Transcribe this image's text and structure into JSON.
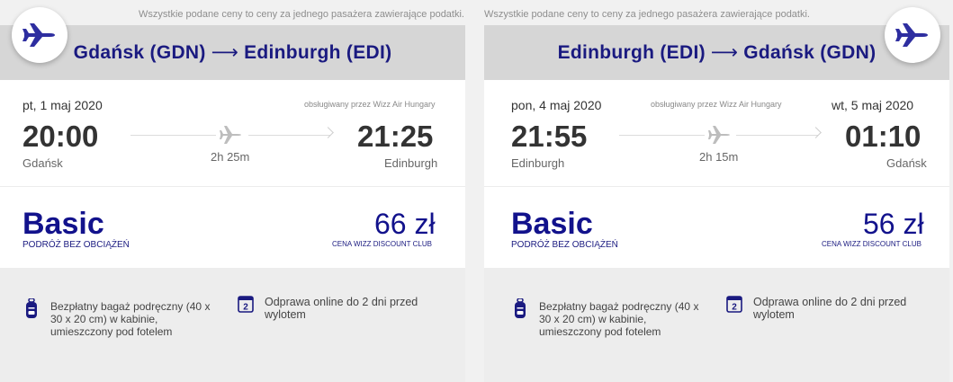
{
  "notice": "Wszystkie podane ceny to ceny za jednego pasażera zawierające podatki.",
  "flights": [
    {
      "route_from": "Gdańsk (GDN)",
      "route_arrow": "⟶",
      "route_to": "Edinburgh (EDI)",
      "dep_date": "pt, 1 maj 2020",
      "arr_date": "",
      "operator": "obsługiwany przez Wizz Air Hungary",
      "dep_time": "20:00",
      "arr_time": "21:25",
      "dep_city": "Gdańsk",
      "arr_city": "Edinburgh",
      "duration": "2h 25m",
      "fare_name": "Basic",
      "fare_sub": "PODRÓŻ BEZ OBCIĄŻEŃ",
      "price": "66 zł",
      "price_sub": "CENA WIZZ DISCOUNT CLUB",
      "perk_bag": "Bezpłatny bagaż podręczny (40 x 30 x 20 cm) w kabinie, umieszczony pod fotelem",
      "perk_checkin": "Odprawa online do 2 dni przed wylotem",
      "checkin_days": "2"
    },
    {
      "route_from": "Edinburgh (EDI)",
      "route_arrow": "⟶",
      "route_to": "Gdańsk (GDN)",
      "dep_date": "pon, 4 maj 2020",
      "arr_date": "wt, 5 maj 2020",
      "operator": "obsługiwany przez Wizz Air Hungary",
      "dep_time": "21:55",
      "arr_time": "01:10",
      "dep_city": "Edinburgh",
      "arr_city": "Gdańsk",
      "duration": "2h 15m",
      "fare_name": "Basic",
      "fare_sub": "PODRÓŻ BEZ OBCIĄŻEŃ",
      "price": "56 zł",
      "price_sub": "CENA WIZZ DISCOUNT CLUB",
      "perk_bag": "Bezpłatny bagaż podręczny (40 x 30 x 20 cm) w kabinie, umieszczony pod fotelem",
      "perk_checkin": "Odprawa online do 2 dni przed wylotem",
      "checkin_days": "2"
    }
  ],
  "icons": {
    "badge_plane": "airplane-icon",
    "timeline_plane": "airplane-icon",
    "bag": "backpack-icon",
    "checkin": "calendar-icon"
  },
  "colors": {
    "brand_blue": "#12128c",
    "header_bg": "#d6d6d6",
    "perks_bg": "#ededed"
  }
}
